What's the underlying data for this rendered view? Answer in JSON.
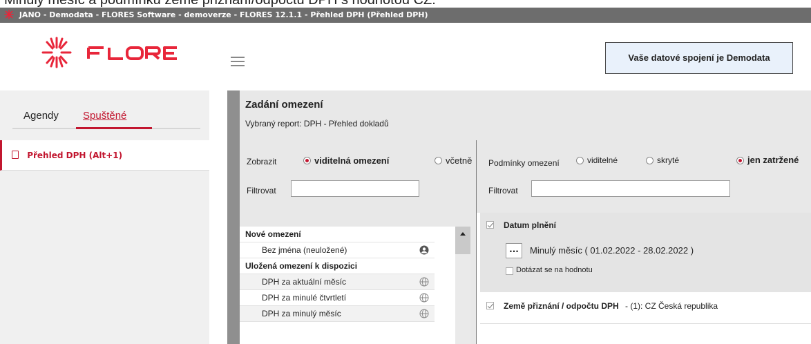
{
  "caption_top": "Minulý měsíc a podmínku země přiznání/odpočtu DPH s hodnotou CZ.",
  "window_title": "JANO - Demodata - FLORES Software - demoverze - FLORES 12.1.1 - Přehled DPH  (Přehled DPH)",
  "header": {
    "logo_text": "FLORES",
    "connection_label": "Vaše datové spojení je Demodata"
  },
  "sidebar": {
    "tab_agendy": "Agendy",
    "tab_spustene": "Spuštěné",
    "items": [
      {
        "label": "Přehled DPH (Alt+1)"
      }
    ]
  },
  "main": {
    "title": "Zadání omezení",
    "subtitle": "Vybraný report: DPH - Přehled dokladů",
    "left": {
      "zobrazit_label": "Zobrazit",
      "opt_viditelna": "viditelná omezení",
      "opt_vcetne": "včetně",
      "filtrovat_label": "Filtrovat",
      "filter_value": "",
      "list": [
        {
          "type": "head",
          "label": "Nové omezení"
        },
        {
          "type": "item",
          "label": "Bez jména (neuložené)",
          "icon": "user-icon"
        },
        {
          "type": "head",
          "label": "Uložená omezení k dispozici"
        },
        {
          "type": "item",
          "label": "DPH za aktuální měsíc",
          "icon": "globe-icon"
        },
        {
          "type": "item",
          "label": "DPH za minulé čtvrtletí",
          "icon": "globe-icon"
        },
        {
          "type": "item",
          "label": "DPH za minulý měsíc",
          "icon": "globe-icon"
        }
      ]
    },
    "right": {
      "podminky_label": "Podmínky omezení",
      "opt_viditelne": "viditelné",
      "opt_skryte": "skryté",
      "opt_zatrzene": "jen zatržené",
      "filtrovat_label": "Filtrovat",
      "filter_value": "",
      "conditions": [
        {
          "title": "Datum plnění",
          "dots": "...",
          "value": "Minulý měsíc ( 01.02.2022 - 28.02.2022 )",
          "ask_label": "Dotázat se na hodnotu"
        },
        {
          "title": "Země přiznání / odpočtu DPH",
          "detail": "- (1): CZ Česká republika"
        }
      ]
    }
  },
  "colors": {
    "accent": "#c2162f",
    "titlebar": "#6d6d6d",
    "panel": "#e8e8e8"
  }
}
